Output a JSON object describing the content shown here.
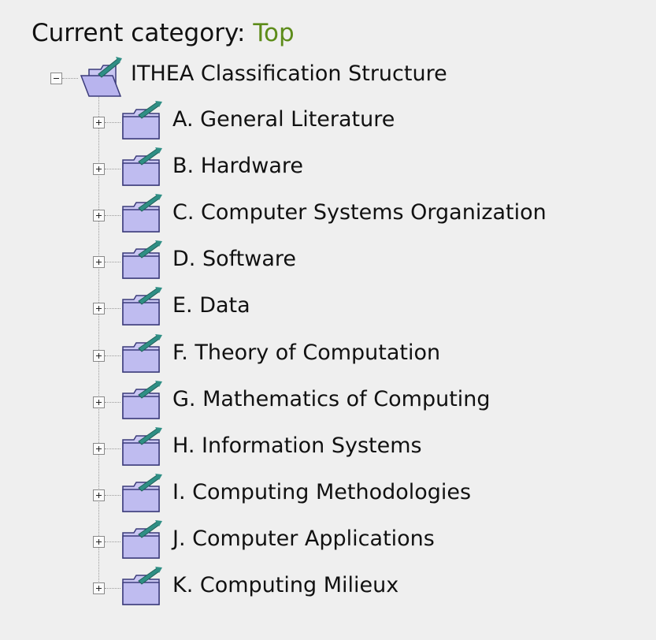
{
  "current_category": {
    "prefix": "Current category: ",
    "value": "Top"
  },
  "tree": {
    "root": {
      "label": "ITHEA Classification Structure",
      "state": "expanded",
      "icon": "folder-open-icon"
    },
    "children": [
      {
        "label": "A. General Literature",
        "state": "collapsed",
        "icon": "folder-icon"
      },
      {
        "label": "B. Hardware",
        "state": "collapsed",
        "icon": "folder-icon"
      },
      {
        "label": "C. Computer Systems Organization",
        "state": "collapsed",
        "icon": "folder-icon"
      },
      {
        "label": "D. Software",
        "state": "collapsed",
        "icon": "folder-icon"
      },
      {
        "label": "E. Data",
        "state": "collapsed",
        "icon": "folder-icon"
      },
      {
        "label": "F. Theory of Computation",
        "state": "collapsed",
        "icon": "folder-icon"
      },
      {
        "label": "G. Mathematics of Computing",
        "state": "collapsed",
        "icon": "folder-icon"
      },
      {
        "label": "H. Information Systems",
        "state": "collapsed",
        "icon": "folder-icon"
      },
      {
        "label": "I. Computing Methodologies",
        "state": "collapsed",
        "icon": "folder-icon"
      },
      {
        "label": "J. Computer Applications",
        "state": "collapsed",
        "icon": "folder-icon"
      },
      {
        "label": "K. Computing Milieux",
        "state": "collapsed",
        "icon": "folder-icon"
      }
    ]
  },
  "colors": {
    "background": "#efefef",
    "category_value": "#5d8c1a",
    "folder_fill": "#c9c6f2",
    "folder_outline": "#3b3b7a",
    "folder_arrow": "#2f8f85"
  }
}
